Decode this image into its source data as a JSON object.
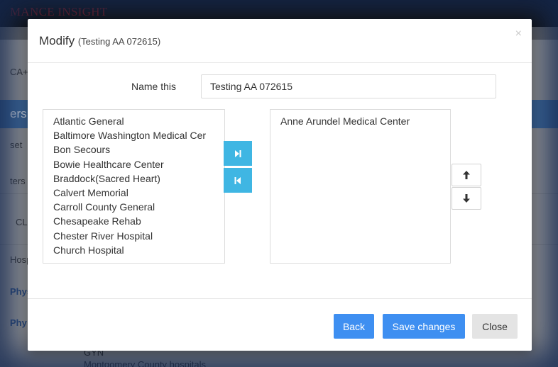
{
  "background": {
    "brand": "MANCE INSIGHT",
    "row_labels": [
      "CA+",
      "ers",
      "set",
      "ters",
      "CLI",
      "Hosp",
      "Phys",
      "Phy"
    ],
    "bottom_lines": [
      "GYN",
      "Montgomery County hospitals"
    ]
  },
  "modal": {
    "title": "Modify",
    "subtitle": "(Testing AA 072615)",
    "close_icon": "×",
    "name_label": "Name this",
    "name_value": "Testing AA 072615",
    "available_items": [
      "Atlantic General",
      "Baltimore Washington Medical Cer",
      "Bon Secours",
      "Bowie Healthcare Center",
      "Braddock(Sacred Heart)",
      "Calvert Memorial",
      "Carroll County General",
      "Chesapeake Rehab",
      "Chester River Hospital",
      "Church Hospital"
    ],
    "selected_items": [
      "Anne Arundel Medical Center"
    ],
    "buttons": {
      "back": "Back",
      "save": "Save changes",
      "close": "Close"
    },
    "icons": {
      "move_right": "move-right-icon",
      "move_left": "move-left-icon",
      "move_up": "arrow-up-icon",
      "move_down": "arrow-down-icon"
    },
    "colors": {
      "primary": "#3e8ff1",
      "move_button": "#3fb6e3",
      "close_button": "#e4e4e4"
    }
  }
}
